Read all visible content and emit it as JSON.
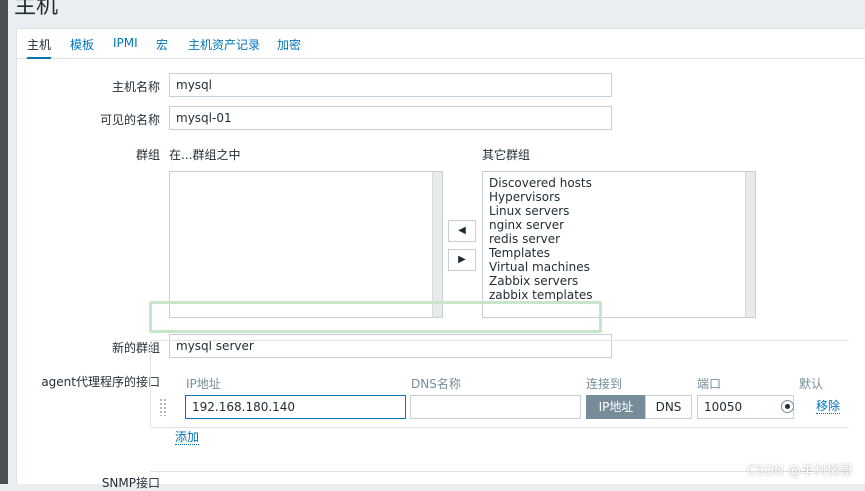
{
  "page": {
    "title": "主机"
  },
  "tabs": [
    {
      "label": "主机",
      "active": true
    },
    {
      "label": "模板"
    },
    {
      "label": "IPMI"
    },
    {
      "label": "宏"
    },
    {
      "label": "主机资产记录"
    },
    {
      "label": "加密"
    }
  ],
  "form": {
    "host_name_label": "主机名称",
    "host_name_value": "mysql",
    "visible_name_label": "可见的名称",
    "visible_name_value": "mysql-01",
    "groups_label": "群组",
    "in_groups_label": "在...群组之中",
    "other_groups_label": "其它群组",
    "in_groups": [],
    "other_groups": [
      "Discovered hosts",
      "Hypervisors",
      "Linux servers",
      "nginx server",
      "redis server",
      "Templates",
      "Virtual machines",
      "Zabbix servers",
      "zabbix templates"
    ],
    "move_left": "◀",
    "move_right": "▶",
    "new_group_label": "新的群组",
    "new_group_value": "mysql server",
    "agent_label": "agent代理程序的接口",
    "snmp_label": "SNMP接口"
  },
  "interface": {
    "col_ip": "IP地址",
    "col_dns": "DNS名称",
    "col_connect": "连接到",
    "col_port": "端口",
    "col_default": "默认",
    "ip_value": "192.168.180.140",
    "dns_value": "",
    "connect_ip": "IP地址",
    "connect_dns": "DNS",
    "port_value": "10050",
    "remove_label": "移除",
    "add_label": "添加"
  },
  "watermark": "CSDN @羊村懒哥",
  "colors": {
    "link": "#0275b8",
    "active_segment": "#768d99",
    "new_group_highlight": "#c9e5c9"
  }
}
